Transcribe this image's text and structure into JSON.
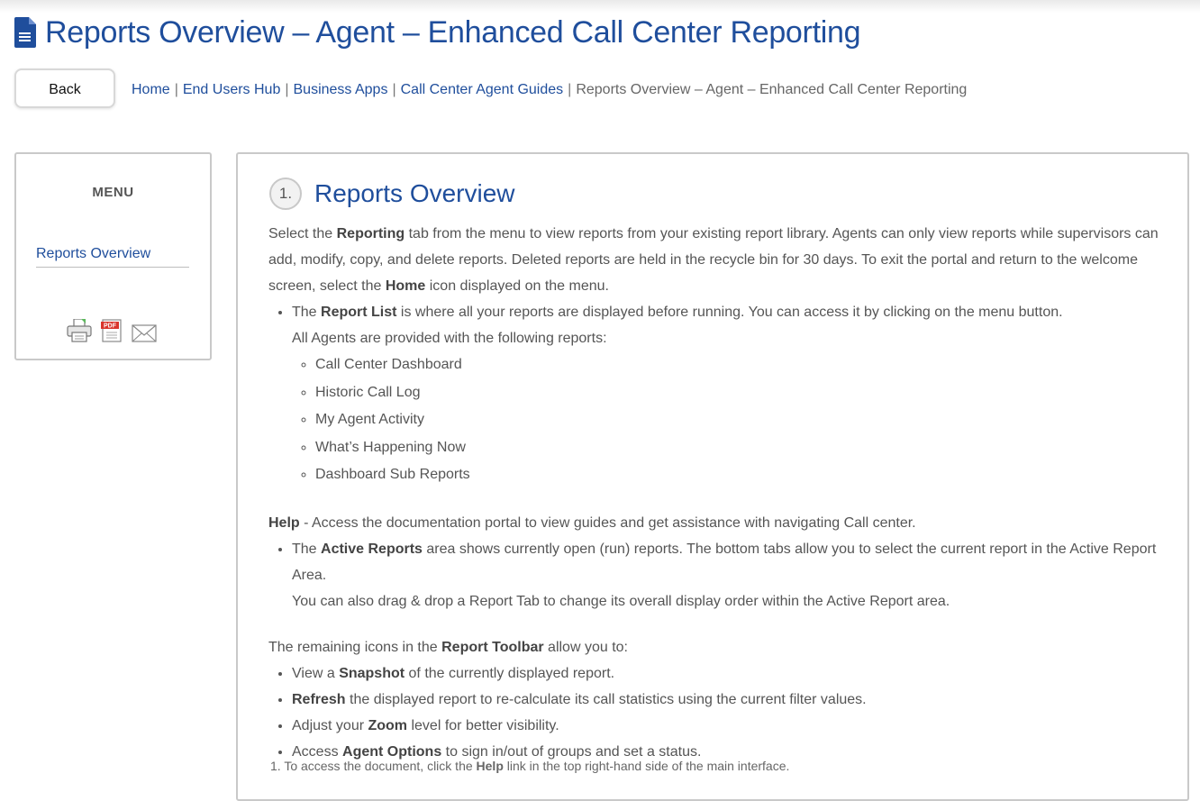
{
  "page": {
    "title": "Reports Overview – Agent – Enhanced Call Center Reporting",
    "back_label": "Back"
  },
  "breadcrumb": {
    "items": [
      "Home",
      "End Users Hub",
      "Business Apps",
      "Call Center Agent Guides"
    ],
    "separator": "|",
    "current": "Reports Overview – Agent – Enhanced Call Center Reporting"
  },
  "menu": {
    "title": "MENU",
    "link": "Reports Overview",
    "icons": [
      "print-icon",
      "pdf-icon",
      "email-icon"
    ],
    "pdf_label": "PDF"
  },
  "content": {
    "step_number": "1.",
    "heading": "Reports Overview",
    "intro": {
      "pre1": "Select the ",
      "b1": "Reporting",
      "mid1": " tab from the menu to view reports from your existing report library. Agents can only view reports while supervisors can add, modify, copy, and delete reports. Deleted reports are held in the recycle bin for 30 days. To exit the portal and return to the welcome screen, select the ",
      "b2": "Home",
      "post": " icon displayed on the menu."
    },
    "report_list": {
      "pre": "The ",
      "b": "Report List",
      "post": " is where all your reports are displayed before running. You can access it by clicking on the menu button.",
      "sub": "All Agents are provided with the following reports:",
      "reports": [
        "Call Center Dashboard",
        "Historic Call Log",
        "My Agent Activity",
        "What’s Happening Now",
        "Dashboard Sub Reports"
      ]
    },
    "help": {
      "b": "Help",
      "post": " - Access the documentation portal to view guides and get assistance with navigating Call center."
    },
    "active_reports": {
      "pre": "The ",
      "b": "Active Reports",
      "post": " area shows currently open (run) reports. The bottom tabs allow you to select the current report in the Active Report Area.",
      "sub": "You can also drag & drop a Report Tab to change its overall display order within the Active Report area."
    },
    "toolbar": {
      "pre": "The remaining icons in the ",
      "b": "Report Toolbar",
      "post": " allow you to:",
      "items": [
        {
          "pre": "View a ",
          "b": "Snapshot",
          "post": " of the currently displayed report."
        },
        {
          "pre": "",
          "b": "Refresh",
          "post": " the displayed report to re-calculate its call statistics using the current filter values."
        },
        {
          "pre": "Adjust your ",
          "b": "Zoom",
          "post": " level for better visibility."
        },
        {
          "pre": "Access ",
          "b": "Agent Options",
          "post": " to sign in/out of groups and set a status."
        }
      ]
    },
    "footnote": {
      "pre": "1. To access the document, click the ",
      "b": "Help",
      "post": " link in the top right-hand side of the main interface."
    }
  },
  "colors": {
    "link": "#1f4e9c",
    "text": "#555555",
    "border": "#c9c9c9"
  }
}
